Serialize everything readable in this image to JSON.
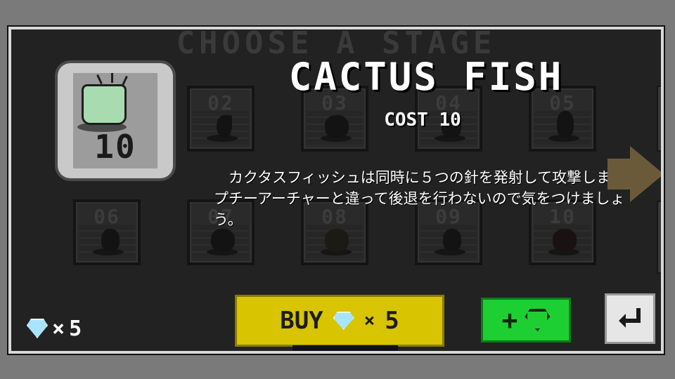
{
  "screen_title": "CHOOSE A STAGE",
  "selected_stage": {
    "name": "CACTUS FISH",
    "cost_label": "COST 10",
    "number": "10",
    "description": "カクタスフィッシュは同時に５つの針を発射して攻撃します。プチーアーチャーと違って後退を行わないので気をつけましょう。"
  },
  "stages": [
    "02",
    "03",
    "04",
    "05",
    "06",
    "07",
    "08",
    "09",
    "10"
  ],
  "gem_balance": {
    "multiplier": "×",
    "count": "5"
  },
  "buy_button": {
    "label": "BUY",
    "multiplier": "×",
    "amount": "5"
  },
  "add_gem_button": {
    "label": "+"
  },
  "icons": {
    "gem": "diamond-icon",
    "back": "return-arrow-icon",
    "next": "right-arrow-icon"
  },
  "colors": {
    "buy": "#d8c400",
    "add_gem": "#1ecf34",
    "panel": "#222222",
    "gem": "#a8e4ff"
  }
}
